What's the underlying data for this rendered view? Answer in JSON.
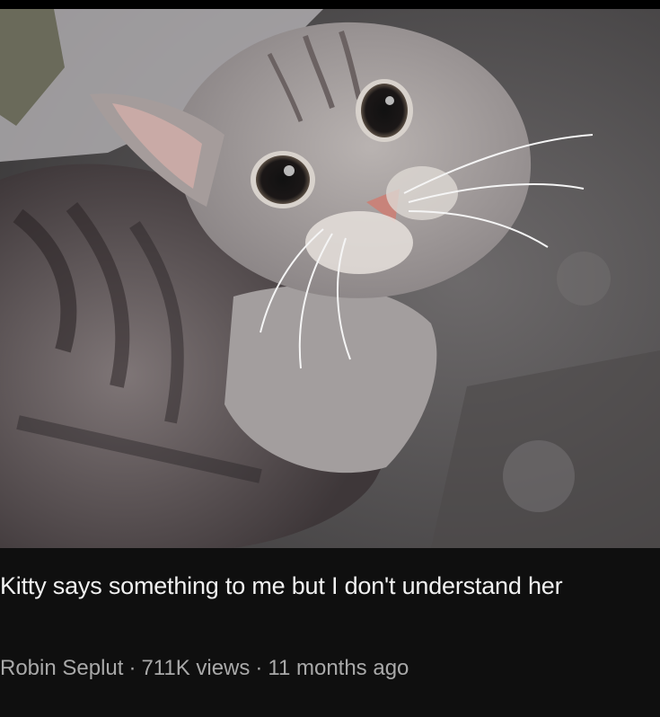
{
  "video": {
    "title": "Kitty says something to me but I don't understand her",
    "channel": "Robin Seplut",
    "views": "711K views",
    "age": "11 months ago",
    "separator": "·"
  },
  "thumbnail": {
    "subject": "gray tabby cat looking up"
  },
  "colors": {
    "background": "#0f0f0f",
    "title_text": "#f1f1f1",
    "meta_text": "#a9a9a9"
  }
}
